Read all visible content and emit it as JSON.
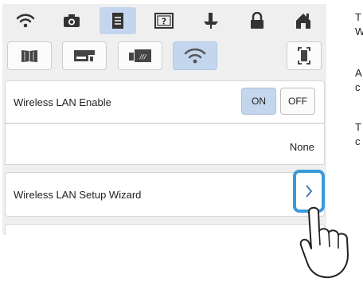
{
  "tabs": [
    {
      "icon": "wifi-icon",
      "active": false
    },
    {
      "icon": "camera-icon",
      "active": false
    },
    {
      "icon": "document-icon",
      "active": true
    },
    {
      "icon": "help-icon",
      "active": false
    },
    {
      "icon": "presser-foot-icon",
      "active": false
    },
    {
      "icon": "lock-icon",
      "active": false
    },
    {
      "icon": "home-icon",
      "active": false
    }
  ],
  "subtabs": [
    {
      "icon": "book-icon",
      "active": false
    },
    {
      "icon": "sewing-machine-icon",
      "active": false
    },
    {
      "icon": "embroidery-unit-icon",
      "active": false
    },
    {
      "icon": "wifi-icon",
      "active": true
    }
  ],
  "rows": {
    "wireless_enable": {
      "label": "Wireless LAN Enable",
      "on": "ON",
      "off": "OFF",
      "selected": "ON"
    },
    "network": {
      "value": "None"
    },
    "setup_wizard": {
      "label": "Wireless LAN Setup Wizard"
    }
  },
  "side_text": [
    "T",
    "W",
    "A",
    "c",
    "T",
    "c"
  ],
  "colors": {
    "active": "#c4d6ee",
    "highlight": "#3a9ad9",
    "background": "#efefef"
  }
}
